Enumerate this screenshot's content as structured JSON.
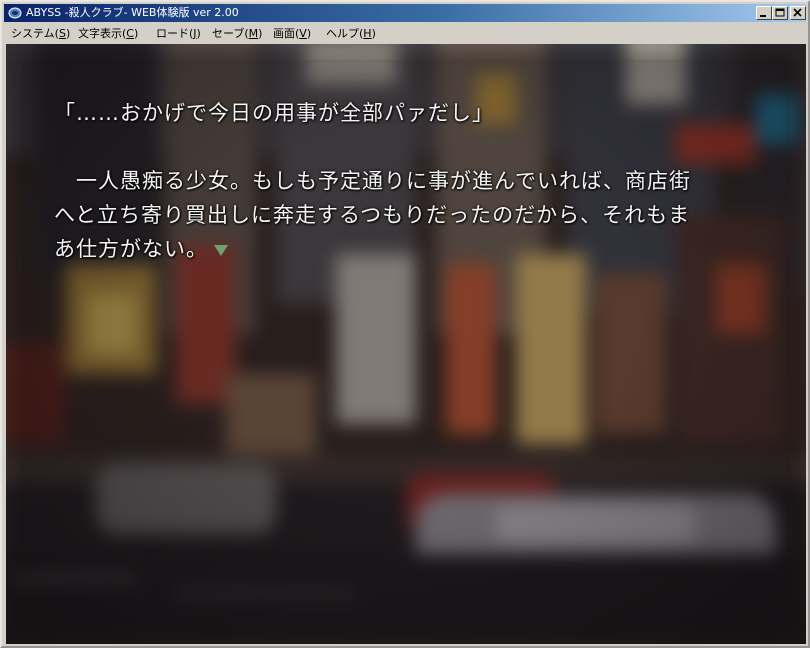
{
  "window": {
    "title": "ABYSS -殺人クラブ- WEB体験版 ver 2.00",
    "minimize_icon": "minimize-icon",
    "maximize_icon": "maximize-icon",
    "close_icon": "close-icon"
  },
  "menu": {
    "items": [
      {
        "label": "システム",
        "key": "S"
      },
      {
        "label": "文字表示",
        "key": "C"
      },
      {
        "label": "ロード",
        "key": "J"
      },
      {
        "label": "セーブ",
        "key": "M"
      },
      {
        "label": "画面",
        "key": "V"
      },
      {
        "label": "ヘルプ",
        "key": "H"
      }
    ]
  },
  "message": {
    "line1": "「……おかげで今日の用事が全部パァだし」",
    "line2": "　一人愚痴る少女。もしも予定通りに事が進んでいれば、商店街",
    "line3": "へと立ち寄り買出しに奔走するつもりだったのだから、それもま",
    "line4": "あ仕方がない。",
    "cursor_icon": "page-advance-triangle-icon"
  },
  "colors": {
    "title_start": "#0a246a",
    "title_end": "#a6caf0",
    "text": "#f4f4f4",
    "cursor": "#6fa06f"
  }
}
